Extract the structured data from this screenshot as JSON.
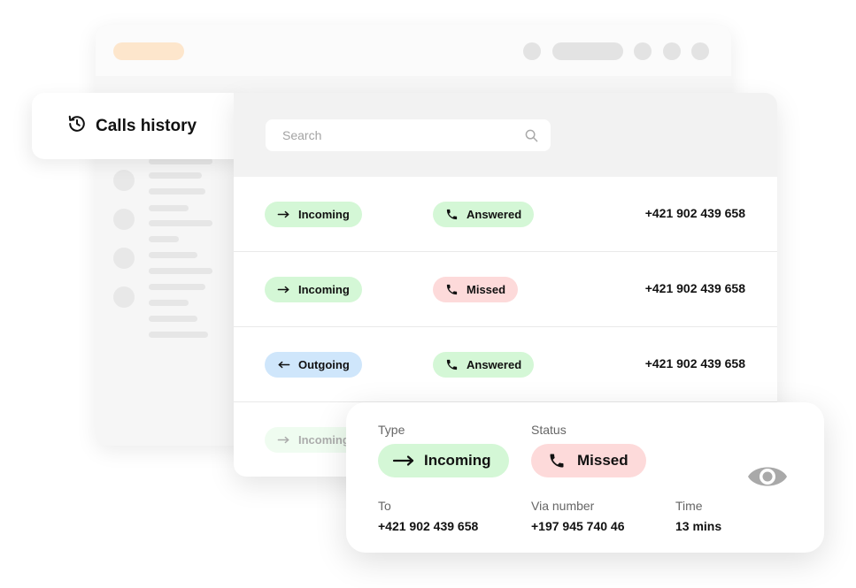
{
  "sidebar": {
    "title": "Calls history",
    "title_icon": "history-icon"
  },
  "search": {
    "placeholder": "Search",
    "icon": "search-icon"
  },
  "calls": [
    {
      "type": "Incoming",
      "type_color": "#d4f7d6",
      "status": "Answered",
      "status_color": "#d4f7d6",
      "number": "+421 902 439 658"
    },
    {
      "type": "Incoming",
      "type_color": "#d4f7d6",
      "status": "Missed",
      "status_color": "#fddada",
      "number": "+421 902 439 658"
    },
    {
      "type": "Outgoing",
      "type_color": "#cfe6fb",
      "status": "Answered",
      "status_color": "#d4f7d6",
      "number": "+421 902 439 658"
    },
    {
      "type": "Incoming",
      "type_color": "#d4f7d6"
    }
  ],
  "detail": {
    "type_label": "Type",
    "type_value": "Incoming",
    "status_label": "Status",
    "status_value": "Missed",
    "to_label": "To",
    "to_value": "+421 902 439 658",
    "via_label": "Via number",
    "via_value": "+197 945 740 46",
    "time_label": "Time",
    "time_value": "13 mins",
    "view_icon": "eye-icon"
  },
  "colors": {
    "incoming_green": "#d4f7d6",
    "missed_red": "#fddada",
    "outgoing_blue": "#cfe6fb",
    "accent_orange": "#fde6cc"
  }
}
